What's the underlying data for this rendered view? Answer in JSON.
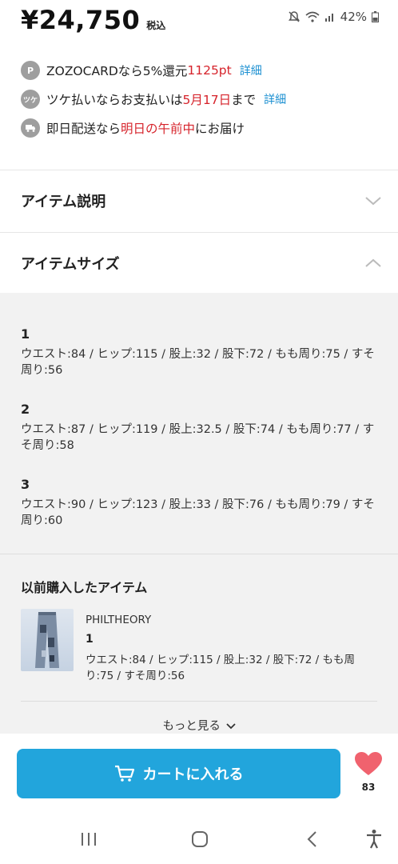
{
  "status": {
    "battery": "42%",
    "icons": [
      "mute-icon",
      "wifi-icon",
      "signal-icon",
      "battery-icon"
    ]
  },
  "price": {
    "amount": "¥24,750",
    "tax_label": "税込"
  },
  "info": {
    "zozocard": {
      "icon": "P",
      "text_before": "ZOZOCARDなら5%還元 ",
      "points": "1125pt",
      "link": "詳細"
    },
    "tsuke": {
      "icon": "ツケ",
      "text_before": "ツケ払いならお支払いは",
      "date": "5月17日",
      "text_after": "まで",
      "link": "詳細"
    },
    "delivery": {
      "text_before": "即日配送なら",
      "highlight": "明日の午前中",
      "text_after": "にお届け"
    }
  },
  "sections": {
    "description": "アイテム説明",
    "size": "アイテムサイズ"
  },
  "sizes": [
    {
      "label": "1",
      "detail": "ウエスト:84 / ヒップ:115 / 股上:32 / 股下:72 / もも周り:75 / すそ周り:56"
    },
    {
      "label": "2",
      "detail": "ウエスト:87 / ヒップ:119 / 股上:32.5 / 股下:74 / もも周り:77 / すそ周り:58"
    },
    {
      "label": "3",
      "detail": "ウエスト:90 / ヒップ:123 / 股上:33 / 股下:76 / もも周り:79 / すそ周り:60"
    }
  ],
  "previous": {
    "title": "以前購入したアイテム",
    "brand": "PHILTHEORY",
    "size_label": "1",
    "detail": "ウエスト:84 / ヒップ:115 / 股上:32 / 股下:72 / もも周り:75 / すそ周り:56",
    "more": "もっと見る"
  },
  "actions": {
    "cart": "カートに入れる",
    "favorite_count": "83"
  },
  "colors": {
    "accent": "#22a5dc",
    "highlight_red": "#d6232b",
    "link_blue": "#1a8fd1",
    "heart": "#f0626e"
  }
}
